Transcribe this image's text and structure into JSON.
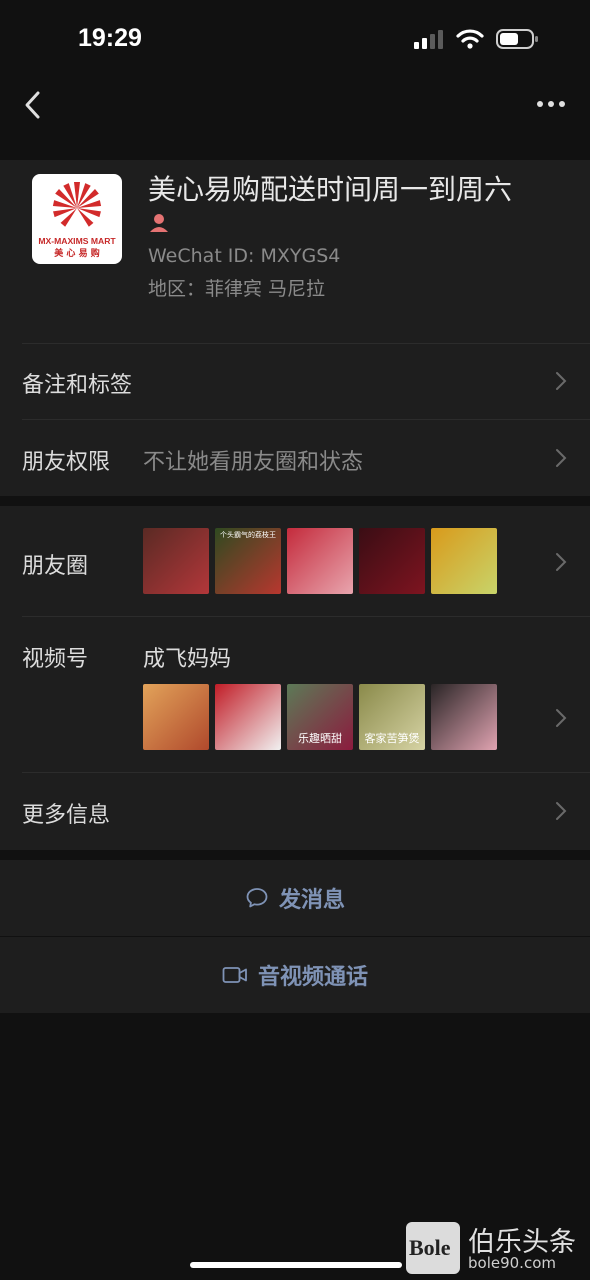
{
  "status_bar": {
    "time": "19:29",
    "battery_level": 0.6
  },
  "profile": {
    "name": "美心易购配送时间周一到周六",
    "wechat_id": "WeChat ID: MXYGS4",
    "region": "地区：菲律宾 马尼拉",
    "avatar_logo_text": "MX-MAXIMS MART",
    "avatar_logo_subtext": "美 心 易 购"
  },
  "rows": {
    "remarks": {
      "label": "备注和标签"
    },
    "privacy": {
      "label": "朋友权限",
      "value": "不让她看朋友圈和状态"
    },
    "moments": {
      "label": "朋友圈",
      "thumbs": [
        {
          "caption": "",
          "colors": [
            "#5a2a24",
            "#b3373a"
          ]
        },
        {
          "caption": "个头霸气的荔枝王",
          "colors": [
            "#2f4a20",
            "#b8372f"
          ]
        },
        {
          "caption": "",
          "colors": [
            "#c42b3c",
            "#e8a5ae"
          ]
        },
        {
          "caption": "",
          "colors": [
            "#3a0d14",
            "#7e1420"
          ]
        },
        {
          "caption": "",
          "colors": [
            "#d99a1b",
            "#c8d46a"
          ]
        }
      ]
    },
    "channels": {
      "label": "视频号",
      "value": "成飞妈妈",
      "thumbs": [
        {
          "caption": "",
          "colors": [
            "#e2a35a",
            "#b0492c"
          ]
        },
        {
          "caption": "",
          "colors": [
            "#c11d27",
            "#f1f1f1"
          ]
        },
        {
          "caption": "乐趣晒甜",
          "colors": [
            "#5c7a57",
            "#8c1b3e"
          ]
        },
        {
          "caption": "客家苦笋煲",
          "colors": [
            "#8a8a4a",
            "#d6d3a4"
          ]
        },
        {
          "caption": "",
          "colors": [
            "#2a2526",
            "#e0a3b1"
          ]
        }
      ]
    },
    "more_info": {
      "label": "更多信息"
    }
  },
  "actions": {
    "message": "发消息",
    "call": "音视频通话"
  },
  "watermark": {
    "logo": "Bole",
    "title": "伯乐头条",
    "domain": "bole90.com"
  },
  "colors": {
    "background": "#111111",
    "cell": "#1e1e1e",
    "link": "#7f93b6"
  }
}
